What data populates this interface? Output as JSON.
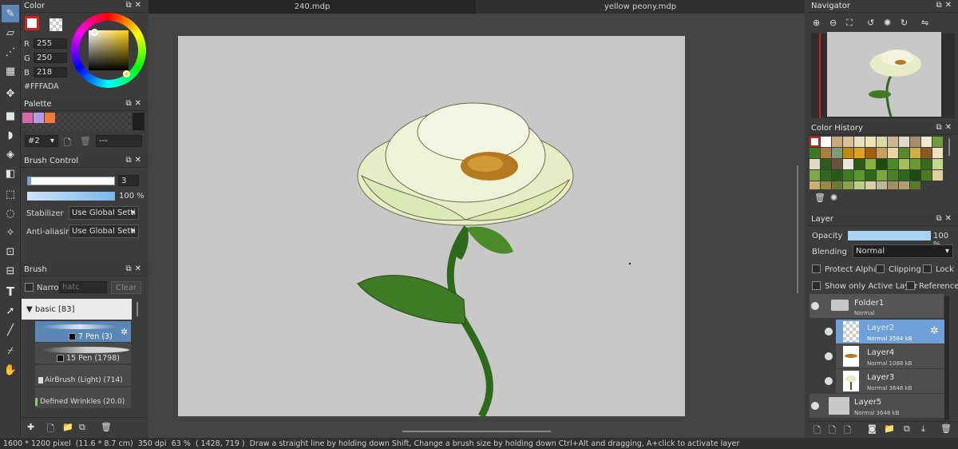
{
  "tabs": [
    {
      "label": "240.mdp",
      "active": true
    },
    {
      "label": "yellow peony.mdp",
      "active": false
    }
  ],
  "color_panel": {
    "title": "Color",
    "r_label": "R",
    "r_value": "255",
    "g_label": "G",
    "g_value": "250",
    "b_label": "B",
    "b_value": "218",
    "hex": "#FFFADA"
  },
  "palette_panel": {
    "title": "Palette",
    "selector": "#2",
    "name": "---",
    "swatches": [
      "#d66aa8",
      "#b59ae6",
      "#f07a3a"
    ]
  },
  "brush_control": {
    "title": "Brush Control",
    "size": "3",
    "opacity": "100 %",
    "stabilizer_label": "Stabilizer",
    "stabilizer_value": "Use Global Setti",
    "antialias_label": "Anti-aliasin",
    "antialias_value": "Use Global Setti"
  },
  "brush_panel": {
    "title": "Brush",
    "narrow_label": "Narro",
    "search_placeholder": "hatc",
    "clear_label": "Clear",
    "category": "basic [83]",
    "items": [
      {
        "label": "7 Pen (3)",
        "selected": true
      },
      {
        "label": "15 Pen (1798)",
        "selected": false
      },
      {
        "label": "AirBrush (Light) (714)",
        "selected": false
      },
      {
        "label": "Defined Wrinkles (20.0)",
        "selected": false
      }
    ]
  },
  "navigator": {
    "title": "Navigator"
  },
  "color_history": {
    "title": "Color History",
    "colors": [
      "#ffffff",
      "#ffffff",
      "#c9a97a",
      "#d6c29a",
      "#e8dfc0",
      "#eae3b8",
      "#ddd8a8",
      "#c9b890",
      "#e2dcc6",
      "#a58e6a",
      "#f0e8d0",
      "#6e9e3c",
      "#3c7a20",
      "#b07a3a",
      "#7e9a78",
      "#c08810",
      "#e0a020",
      "#a06010",
      "#c8a060",
      "#e8d8a0",
      "#5a8a2a",
      "#d0b040",
      "#8a5a20",
      "#f0e0c0",
      "#e0d8c0",
      "#2c5a1a",
      "#6a5040",
      "#e8e8d8",
      "#2a5a18",
      "#8ab040",
      "#1e4a10",
      "#4a8a28",
      "#a0c060",
      "#6a9a30",
      "#3a6a1c",
      "#c0d890",
      "#80a848",
      "#2e6a1a",
      "#2a5a14",
      "#3c7a24",
      "#5a9a2c",
      "#2a6a18",
      "#7aa840",
      "#4a8028",
      "#2c6a1c",
      "#1e4a14",
      "#4a7a20",
      "#e0d0a0",
      "#c8b070",
      "#9a8a40",
      "#6a7a30",
      "#8aa050",
      "#bfcf80",
      "#d8d0a0",
      "#c0b890",
      "#a09060",
      "#b0a070",
      "#5a7a2a"
    ]
  },
  "layer_panel": {
    "title": "Layer",
    "opacity_label": "Opacity",
    "opacity_value": "100 %",
    "opacity_level": 1.0,
    "blending_label": "Blending",
    "blending_value": "Normal",
    "protect_alpha": "Protect Alpha",
    "clipping": "Clipping",
    "lock": "Lock",
    "show_only_active": "Show only Active Layer",
    "reference": "Reference",
    "layers": [
      {
        "name": "Folder1",
        "sub": "Normal"
      },
      {
        "name": "Layer2",
        "sub": "Normal  3584 kB",
        "selected": true
      },
      {
        "name": "Layer4",
        "sub": "Normal  1088 kB"
      },
      {
        "name": "Layer3",
        "sub": "Normal  3648 kB"
      },
      {
        "name": "Layer5",
        "sub": "Normal  3648 kB"
      }
    ]
  },
  "status": {
    "size": "1600 * 1200 pixel",
    "cm": "(11.6 * 8.7 cm)",
    "dpi": "350 dpi",
    "zoom": "63 %",
    "coords": "( 1428, 719 )",
    "hint": "Draw a straight line by holding down Shift, Change a brush size by holding down Ctrl+Alt and dragging, A+click to activate layer"
  },
  "colors": {
    "accent": "#5a87b6",
    "selected_layer": "#6fa0d8",
    "panel_bg": "#3c3c3c",
    "canvas_bg": "#c8c8c8"
  }
}
